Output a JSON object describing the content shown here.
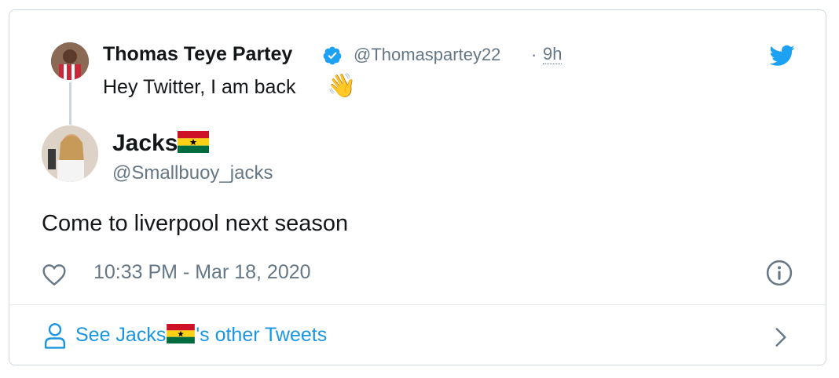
{
  "parent_tweet": {
    "name": "Thomas Teye Partey",
    "handle": "@Thomaspartey22",
    "separator": "·",
    "time": "9h",
    "text": "Hey Twitter, I am back",
    "emoji": "👋"
  },
  "main_tweet": {
    "name": "Jacks",
    "handle": "@Smallbuoy_jacks",
    "text": "Come to liverpool next season",
    "date": "10:33 PM - Mar 18, 2020"
  },
  "footer": {
    "link_prefix": "See Jacks",
    "link_suffix": "'s other Tweets"
  },
  "colors": {
    "twitter_blue": "#1da1f2",
    "link_blue": "#1b95e0",
    "muted_gray": "#657786",
    "text_dark": "#14171a"
  },
  "icons": {
    "verified": "verified-badge-icon",
    "twitter": "twitter-bird-icon",
    "heart": "heart-icon",
    "info": "info-icon",
    "person": "person-icon",
    "chevron": "chevron-right-icon",
    "flag": "ghana-flag-icon"
  }
}
